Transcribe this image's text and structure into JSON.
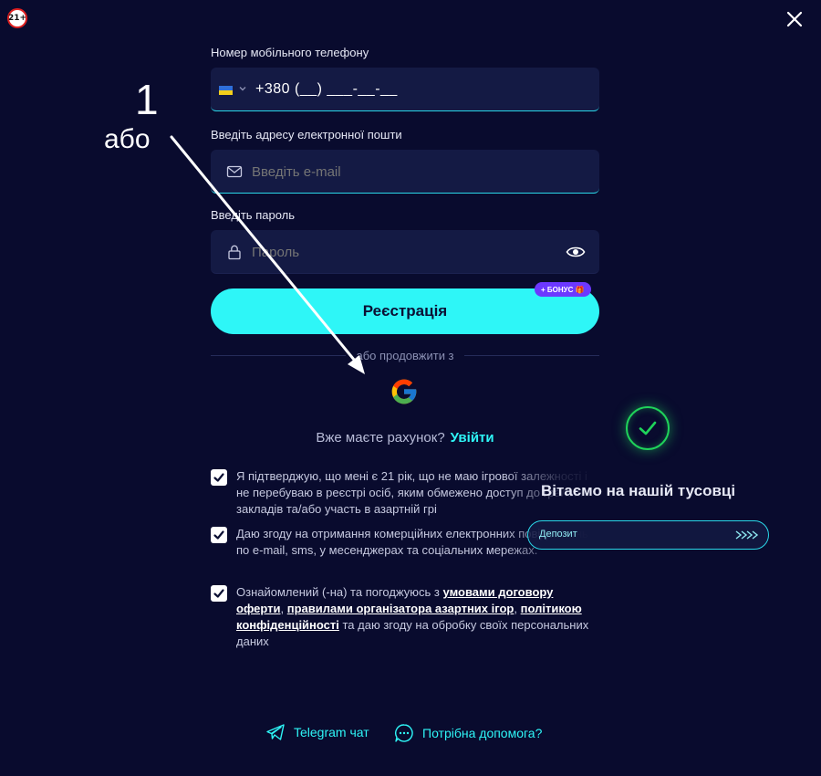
{
  "age_badge": "21+",
  "annotation": {
    "number": "1",
    "or_word": "або"
  },
  "phone": {
    "label": "Номер мобільного телефону",
    "value": "+380 (__) ___-__-__",
    "flag_icon": "ukraine-flag-icon"
  },
  "email": {
    "label": "Введіть адресу електронної пошти",
    "placeholder": "Введіть e-mail"
  },
  "password": {
    "label": "Введіть пароль",
    "placeholder": "Пароль"
  },
  "register": {
    "label": "Реєстрація",
    "bonus_badge": "+ БОНУС 🎁"
  },
  "social": {
    "or_continue": "або продовжити з",
    "google_icon": "google-icon"
  },
  "account": {
    "question": "Вже маєте рахунок?",
    "login": "Увійти"
  },
  "consents": [
    {
      "text": "Я підтверджую, що мені є 21 рік, що не маю ігрової залежності і не перебуваю в реєстрі осіб, яким обмежено доступ до гральних закладів та/або участь в азартній грі",
      "checked": true
    },
    {
      "text": "Даю згоду на отримання комерційних електронних повідомлень по e-mail, sms, у месенджерах та соціальних мережах.",
      "checked": true
    },
    {
      "text_before": "Ознайомлений (-на) та погоджуюсь з",
      "link1": "умовами договору оферти",
      "sep1": ",",
      "link2": "правилами організатора азартних ігор",
      "sep2": ",",
      "link3": "політикою конфіденційності",
      "text_after": "та даю згоду на обробку своїх персональних даних",
      "checked": true
    }
  ],
  "welcome": {
    "title": "Вітаємо на нашій тусовці",
    "deposit_label": "Депозит"
  },
  "footer": {
    "telegram": "Telegram чат",
    "help": "Потрібна допомога?"
  },
  "colors": {
    "background": "#090b2e",
    "accent": "#2ef6f7",
    "bonus": "#6c38ff",
    "success": "#1fd35a"
  }
}
